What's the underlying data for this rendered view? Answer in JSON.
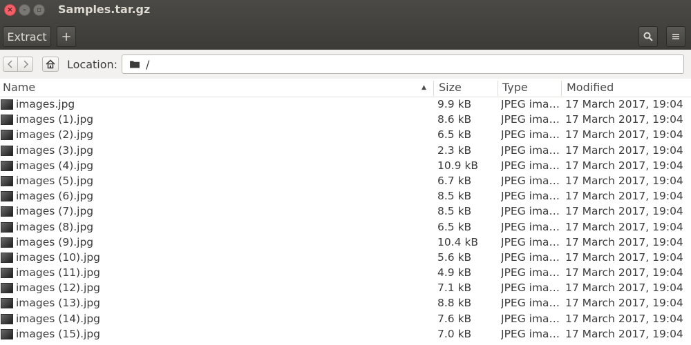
{
  "window": {
    "title": "Samples.tar.gz"
  },
  "toolbar": {
    "extract_label": "Extract",
    "add_label": "+",
    "search_icon": "search-icon",
    "menu_icon": "hamburger-menu-icon"
  },
  "location": {
    "label": "Location:",
    "path": "/"
  },
  "columns": {
    "name": "Name",
    "size": "Size",
    "type": "Type",
    "modified": "Modified"
  },
  "files": [
    {
      "name": "images.jpg",
      "size": "9.9 kB",
      "type": "JPEG ima…",
      "modified": "17 March 2017, 19:04"
    },
    {
      "name": "images (1).jpg",
      "size": "8.6 kB",
      "type": "JPEG ima…",
      "modified": "17 March 2017, 19:04"
    },
    {
      "name": "images (2).jpg",
      "size": "6.5 kB",
      "type": "JPEG ima…",
      "modified": "17 March 2017, 19:04"
    },
    {
      "name": "images (3).jpg",
      "size": "2.3 kB",
      "type": "JPEG ima…",
      "modified": "17 March 2017, 19:04"
    },
    {
      "name": "images (4).jpg",
      "size": "10.9 kB",
      "type": "JPEG ima…",
      "modified": "17 March 2017, 19:04"
    },
    {
      "name": "images (5).jpg",
      "size": "6.7 kB",
      "type": "JPEG ima…",
      "modified": "17 March 2017, 19:04"
    },
    {
      "name": "images (6).jpg",
      "size": "8.5 kB",
      "type": "JPEG ima…",
      "modified": "17 March 2017, 19:04"
    },
    {
      "name": "images (7).jpg",
      "size": "8.5 kB",
      "type": "JPEG ima…",
      "modified": "17 March 2017, 19:04"
    },
    {
      "name": "images (8).jpg",
      "size": "6.5 kB",
      "type": "JPEG ima…",
      "modified": "17 March 2017, 19:04"
    },
    {
      "name": "images (9).jpg",
      "size": "10.4 kB",
      "type": "JPEG ima…",
      "modified": "17 March 2017, 19:04"
    },
    {
      "name": "images (10).jpg",
      "size": "5.6 kB",
      "type": "JPEG ima…",
      "modified": "17 March 2017, 19:04"
    },
    {
      "name": "images (11).jpg",
      "size": "4.9 kB",
      "type": "JPEG ima…",
      "modified": "17 March 2017, 19:04"
    },
    {
      "name": "images (12).jpg",
      "size": "7.1 kB",
      "type": "JPEG ima…",
      "modified": "17 March 2017, 19:04"
    },
    {
      "name": "images (13).jpg",
      "size": "8.8 kB",
      "type": "JPEG ima…",
      "modified": "17 March 2017, 19:04"
    },
    {
      "name": "images (14).jpg",
      "size": "7.6 kB",
      "type": "JPEG ima…",
      "modified": "17 March 2017, 19:04"
    },
    {
      "name": "images (15).jpg",
      "size": "7.0 kB",
      "type": "JPEG ima…",
      "modified": "17 March 2017, 19:04"
    }
  ]
}
